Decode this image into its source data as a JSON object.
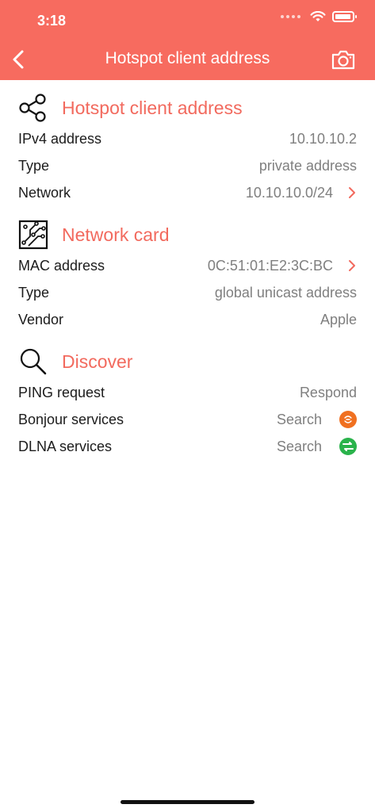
{
  "status": {
    "time": "3:18"
  },
  "nav": {
    "title": "Hotspot client address"
  },
  "sections": {
    "hotspot": {
      "title": "Hotspot client address",
      "rows": [
        {
          "label": "IPv4 address",
          "value": "10.10.10.2"
        },
        {
          "label": "Type",
          "value": "private address"
        },
        {
          "label": "Network",
          "value": "10.10.10.0/24"
        }
      ]
    },
    "card": {
      "title": "Network card",
      "rows": [
        {
          "label": "MAC address",
          "value": "0C:51:01:E2:3C:BC"
        },
        {
          "label": "Type",
          "value": "global unicast address"
        },
        {
          "label": "Vendor",
          "value": "Apple"
        }
      ]
    },
    "discover": {
      "title": "Discover",
      "rows": [
        {
          "label": "PING request",
          "value": "Respond"
        },
        {
          "label": "Bonjour services",
          "value": "Search"
        },
        {
          "label": "DLNA services",
          "value": "Search"
        }
      ]
    }
  },
  "colors": {
    "accent": "#f76b5f",
    "title": "#f26a5e",
    "bonjour_badge": "#f07020",
    "dlna_badge": "#2ab34b"
  },
  "icons": [
    "chevron-left-icon",
    "camera-icon",
    "share-icon",
    "circuit-icon",
    "search-icon",
    "chevron-right-icon",
    "bonjour-icon",
    "dlna-icon"
  ]
}
